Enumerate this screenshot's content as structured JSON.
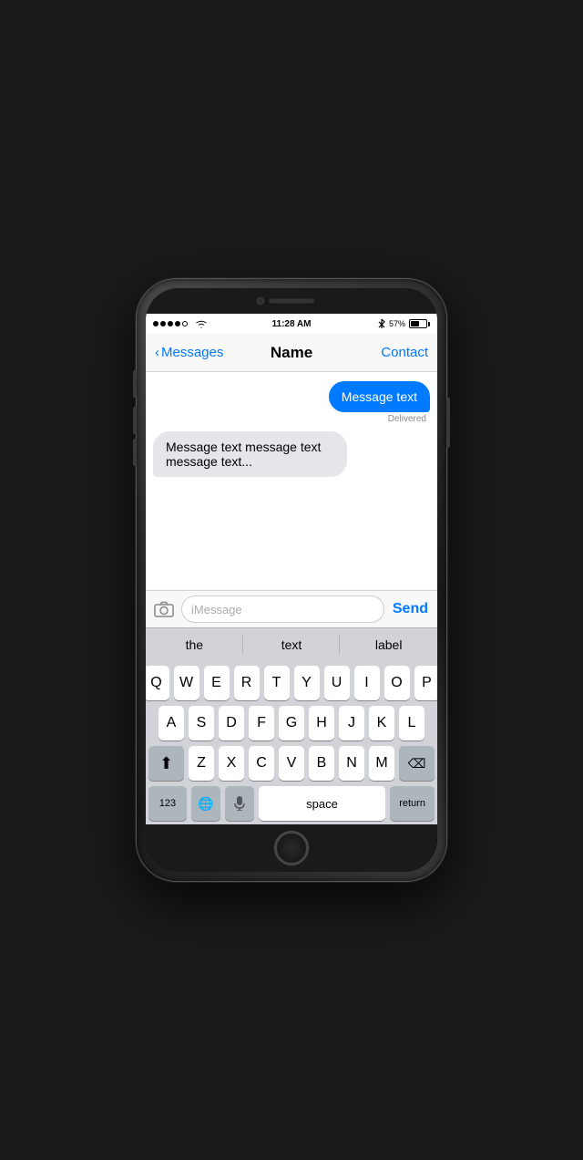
{
  "phone": {
    "status_bar": {
      "time": "11:28 AM",
      "battery_percent": "57%",
      "signal_dots": [
        "filled",
        "filled",
        "filled",
        "filled",
        "empty"
      ]
    },
    "nav": {
      "back_label": "Messages",
      "title": "Name",
      "contact_label": "Contact"
    },
    "messages": [
      {
        "type": "sent",
        "text": "Message text",
        "status": "Delivered"
      },
      {
        "type": "received",
        "text": "Message text message text message text..."
      }
    ],
    "input": {
      "placeholder": "iMessage",
      "send_label": "Send",
      "camera_icon": "📷"
    },
    "autocomplete": {
      "items": [
        "the",
        "text",
        "label"
      ]
    },
    "keyboard": {
      "rows": [
        [
          "Q",
          "W",
          "E",
          "R",
          "T",
          "Y",
          "U",
          "I",
          "O",
          "P"
        ],
        [
          "A",
          "S",
          "D",
          "F",
          "G",
          "H",
          "J",
          "K",
          "L"
        ],
        [
          "Z",
          "X",
          "C",
          "V",
          "B",
          "N",
          "M"
        ],
        [
          "123",
          "🌐",
          "🎤",
          "space",
          "return"
        ]
      ],
      "shift_label": "⬆",
      "delete_label": "⌫",
      "numbers_label": "123",
      "globe_label": "🌐",
      "mic_label": "🎤",
      "space_label": "space",
      "return_label": "return"
    }
  }
}
